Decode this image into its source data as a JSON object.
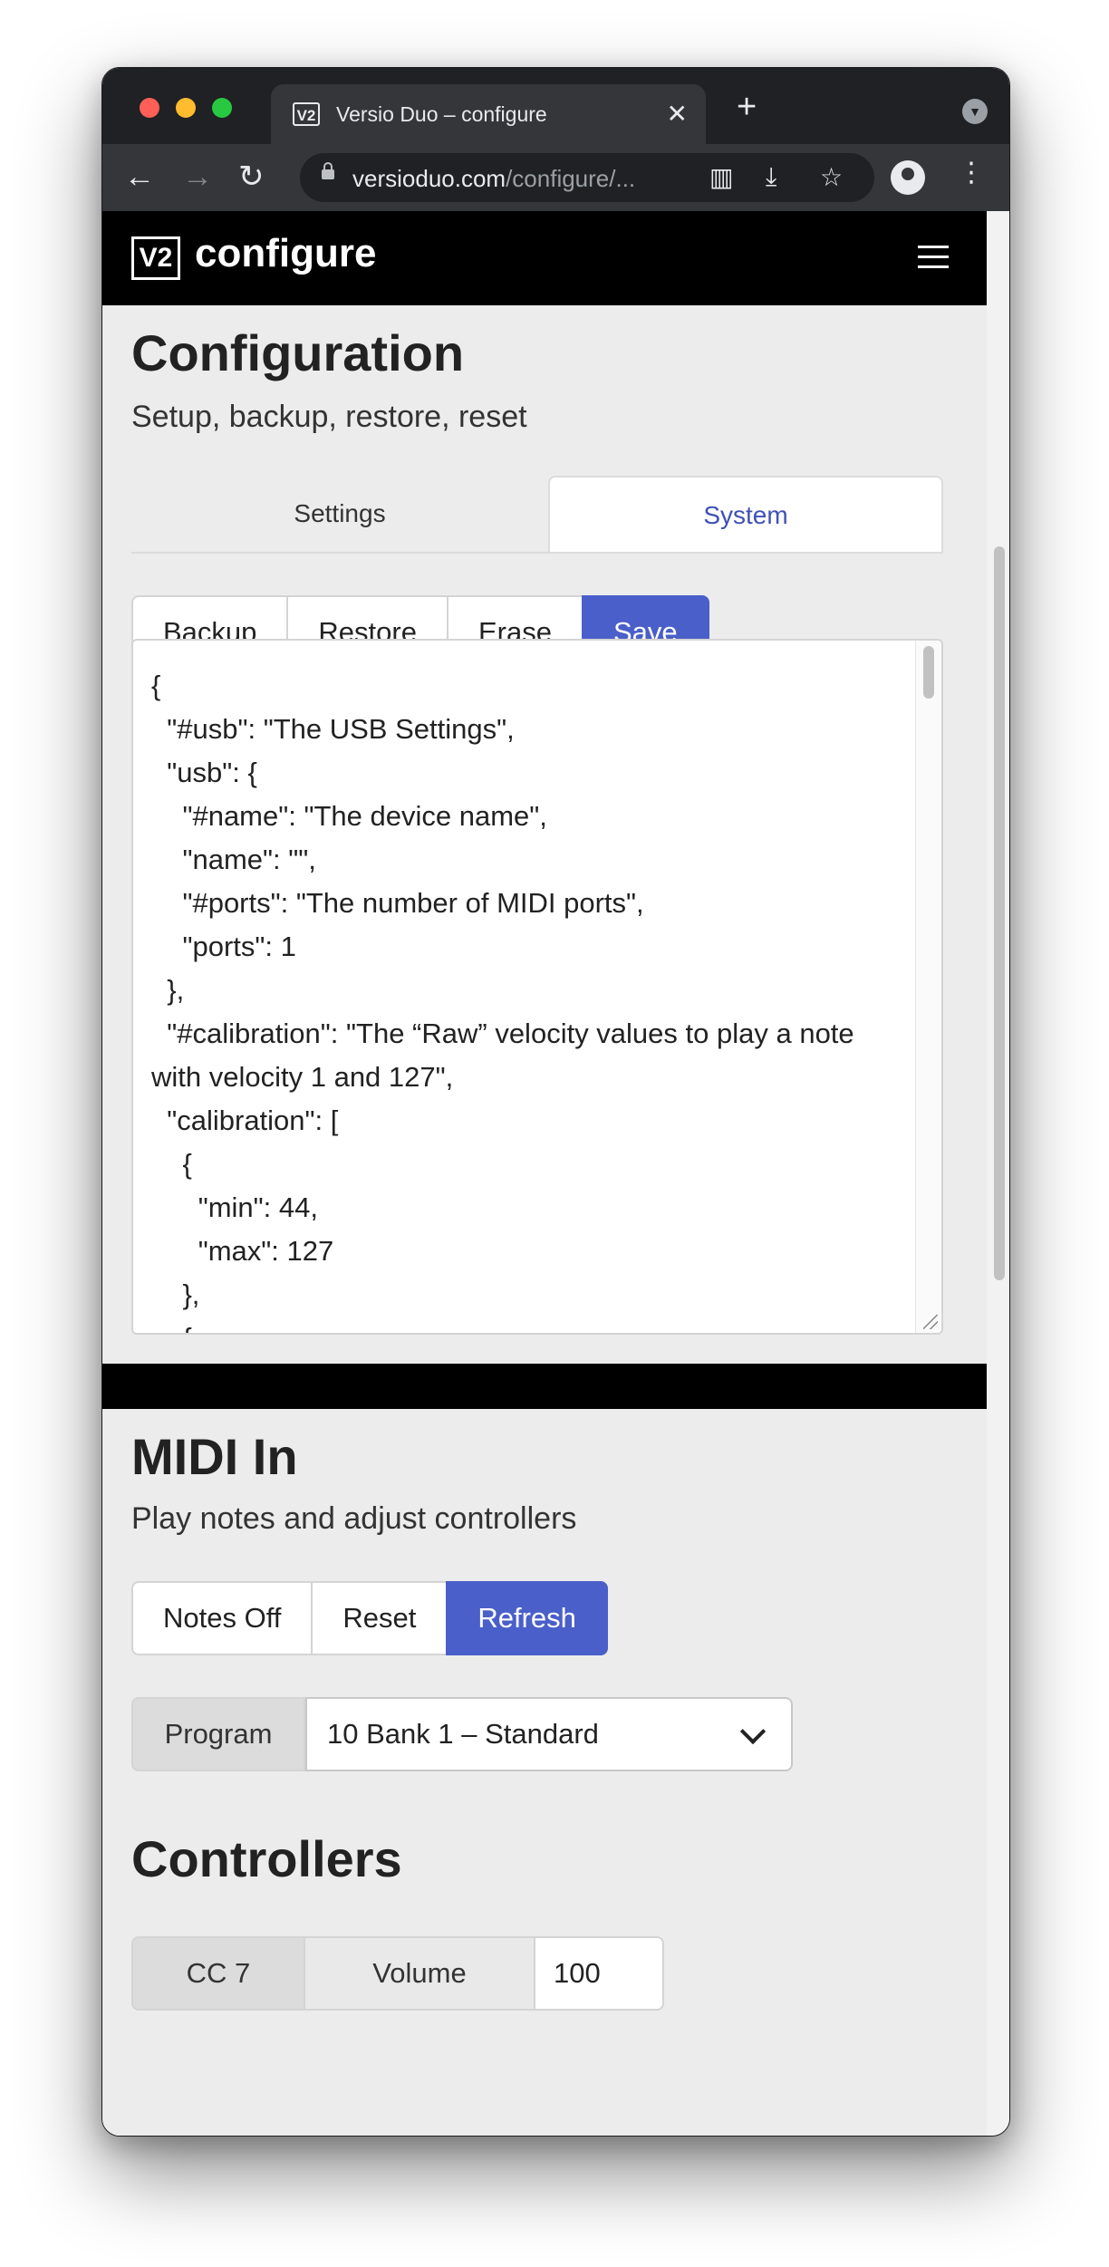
{
  "browser": {
    "tab_title": "Versio Duo – configure",
    "favicon_text": "V2",
    "url_host": "versioduo.com",
    "url_path": "/configure/..."
  },
  "site": {
    "logo_text": "V2",
    "brand": "configure"
  },
  "configuration": {
    "title": "Configuration",
    "subtitle": "Setup, backup, restore, reset",
    "tabs": [
      {
        "label": "Settings",
        "active": false
      },
      {
        "label": "System",
        "active": true
      }
    ],
    "buttons": {
      "backup": "Backup",
      "restore": "Restore",
      "erase": "Erase",
      "save": "Save"
    },
    "json_text": "{\n  \"#usb\": \"The USB Settings\",\n  \"usb\": {\n    \"#name\": \"The device name\",\n    \"name\": \"\",\n    \"#ports\": \"The number of MIDI ports\",\n    \"ports\": 1\n  },\n  \"#calibration\": \"The “Raw” velocity values to play a note with velocity 1 and 127\",\n  \"calibration\": [\n    {\n      \"min\": 44,\n      \"max\": 127\n    },\n    {"
  },
  "midi_in": {
    "title": "MIDI In",
    "subtitle": "Play notes and adjust controllers",
    "buttons": {
      "notes_off": "Notes Off",
      "reset": "Reset",
      "refresh": "Refresh"
    },
    "program_label": "Program",
    "program_value": "10 Bank 1 – Standard"
  },
  "controllers": {
    "title": "Controllers",
    "items": [
      {
        "cc": "CC 7",
        "name": "Volume",
        "value": "100"
      }
    ]
  },
  "colors": {
    "accent": "#4a5fc9",
    "tab_active_text": "#3f51b5",
    "header_bg": "#000000"
  }
}
